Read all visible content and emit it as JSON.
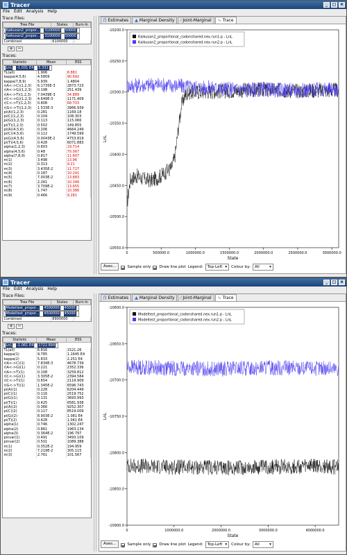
{
  "windows": [
    {
      "title": "Tracer",
      "menu": [
        "File",
        "Edit",
        "Analysis",
        "Help"
      ],
      "trace_files_label": "Trace Files:",
      "trace_file_headers": [
        "Tree File",
        "States",
        "Burn-In"
      ],
      "trace_files": [
        [
          "Kaikusan2_propor...",
          "3100000",
          "50000"
        ],
        [
          "Kaikusan2_propor...",
          "3100000",
          "50000"
        ],
        [
          "Combined",
          "6100000",
          "-"
        ]
      ],
      "trace_files_selected": [
        0,
        1
      ],
      "add_label": "+",
      "remove_label": "−",
      "traces_label": "Traces:",
      "trace_headers": [
        "Statistic",
        "Mean",
        "ESS"
      ],
      "traces": [
        [
          "LnL",
          "-1.031 E4",
          "5.331"
        ],
        [
          "TL(all)",
          "1.906",
          "8.881"
        ],
        [
          "kappa(4,5,6)",
          "4.5809",
          "90.692"
        ],
        [
          "kappa(7,8,9)",
          "5.939",
          "1.4804"
        ],
        [
          "r(A<->C)(1,2,3)",
          "6.1735E-3",
          "2873.723"
        ],
        [
          "r(A<->G)(1,2,3)",
          "0.198",
          "251.439"
        ],
        [
          "r(A<->T)(1,2,3)",
          "7.0439E-3",
          "34.889"
        ],
        [
          "r(C<->G)(1,2,3)",
          "4.649E-3",
          "1171.409"
        ],
        [
          "r(C<->T)(1,2,3)",
          "0.808",
          "68.703"
        ],
        [
          "r(G<->T)(1,2,3)",
          "1.533E-3",
          "3966.939"
        ],
        [
          "pi(A)(1,2,3)",
          "0.281",
          "1169.18"
        ],
        [
          "pi(C)(1,2,3)",
          "0.104",
          "108.303"
        ],
        [
          "pi(G)(1,2,3)",
          "0.113",
          "115.066"
        ],
        [
          "pi(T)(1,2,3)",
          "0.502",
          "149.855"
        ],
        [
          "pi(A)(4,5,6)",
          "0.206",
          "4664.249"
        ],
        [
          "pi(C)(4,5,6)",
          "0.112",
          "1749.599"
        ],
        [
          "pi(G)(4,5,6)",
          "0.0043E-2",
          "4753.819"
        ],
        [
          "pi(T)(4,5,6)",
          "0.428",
          "6071.883"
        ],
        [
          "alpha(1,2,3)",
          "0.603",
          "19.714"
        ],
        [
          "alpha(4,5,6)",
          "0.48",
          "70.067"
        ],
        [
          "alpha(7,8,9)",
          "0.817",
          "11.607"
        ],
        [
          "m(1)",
          "3.498",
          "13.96"
        ],
        [
          "m(2)",
          "0.313",
          "9.21"
        ],
        [
          "m(3)",
          "3.435E-2",
          "11.727"
        ],
        [
          "m(4)",
          "0.187",
          "10.241"
        ],
        [
          "m(5)",
          "7.003E-2",
          "13.883"
        ],
        [
          "m(6)",
          "2.261",
          "10.346"
        ],
        [
          "m(7)",
          "3.709E-2",
          "13.655"
        ],
        [
          "m(8)",
          "1.747",
          "10.386"
        ],
        [
          "m(9)",
          "0.466",
          "9.281"
        ]
      ],
      "trace_ess_red": [
        0,
        1,
        2,
        6,
        8,
        18,
        19,
        20,
        21,
        22,
        23,
        24,
        25,
        26,
        27,
        28,
        29
      ],
      "tabs": [
        "Estimates",
        "Marginal Density",
        "Joint-Marginal",
        "Trace"
      ],
      "active_tab": 3,
      "legend": [
        "Kaikusan2_proportional_codonshared.nex.run1.p - LnL",
        "Kaikusan2_proportional_codonshared.nex.run2.p - LnL"
      ],
      "controls": {
        "axes": "Axes...",
        "sample_only": "Sample only",
        "draw_line": "Draw line plot",
        "legend_label": "Legend:",
        "legend_value": "Top-Left",
        "colour_label": "Colour by:",
        "colour_value": "All"
      },
      "colors": {
        "series1": "#111111",
        "series2": "#4a3cf0"
      },
      "chart_data": {
        "type": "line",
        "xlabel": "State",
        "ylabel": "LnL",
        "xlim": [
          0,
          3100000
        ],
        "ylim": [
          -10550,
          -10200
        ],
        "xticks": [
          "0",
          "500000.0",
          "1000000.0",
          "1500000.0",
          "2000000.0",
          "2500000.0",
          "3000000.0"
        ],
        "yticks": [
          "-10200.0",
          "-10250.0",
          "-10300.0",
          "-10350.0",
          "-10400.0",
          "-10450.0",
          "-10500.0",
          "-10550.0"
        ],
        "series": [
          {
            "name": "Kaikusan2_proportional_codonshared.nex.run1.p - LnL",
            "color": "#111111",
            "x": [
              0,
              50000,
              150000,
              250000,
              350000,
              450000,
              550000,
              650000,
              700000,
              750000,
              800000,
              850000,
              900000,
              1000000,
              1500000,
              2000000,
              2500000,
              3000000
            ],
            "y": [
              -10480,
              -10440,
              -10435,
              -10440,
              -10442,
              -10438,
              -10430,
              -10422,
              -10405,
              -10360,
              -10320,
              -10305,
              -10300,
              -10300,
              -10298,
              -10296,
              -10298,
              -10297
            ]
          },
          {
            "name": "Kaikusan2_proportional_codonshared.nex.run2.p - LnL",
            "color": "#4a3cf0",
            "x": [
              0,
              500000,
              1000000,
              1500000,
              2000000,
              2500000,
              3000000
            ],
            "y": [
              -10290,
              -10288,
              -10292,
              -10295,
              -10296,
              -10297,
              -10296
            ]
          }
        ]
      }
    },
    {
      "title": "Tracer",
      "menu": [
        "File",
        "Edit",
        "Analysis",
        "Help"
      ],
      "trace_files_label": "Trace Files:",
      "trace_file_headers": [
        "Tree File",
        "States",
        "Burn-In"
      ],
      "trace_files": [
        [
          "Modeltest_propor...",
          "4500000",
          "45000"
        ],
        [
          "Modeltest_propor...",
          "4500000",
          "45000"
        ],
        [
          "Combined",
          "8900000",
          "-"
        ]
      ],
      "trace_files_selected": [
        0,
        1
      ],
      "add_label": "+",
      "remove_label": "−",
      "traces_label": "Traces:",
      "trace_headers": [
        "Statistic",
        "Mean",
        "ESS"
      ],
      "traces": [
        [
          "LnL",
          "-1.061 E4",
          "1722.894"
        ],
        [
          "TL(all)",
          "6.816",
          "1521.26"
        ],
        [
          "kappa(1)",
          "9.785",
          "1.1645 E4"
        ],
        [
          "kappa(2)",
          "5.833",
          "2.251 E4"
        ],
        [
          "r(A<->C)(1)",
          "7.834E-3",
          "4678.739"
        ],
        [
          "r(A<->G)(1)",
          "0.221",
          "2352.336"
        ],
        [
          "r(A<->T)(1)",
          "0.108",
          "3259.812"
        ],
        [
          "r(C<->G)(1)",
          "3.305E-2",
          "2394.584"
        ],
        [
          "r(C<->T)(1)",
          "0.654",
          "2119.909"
        ],
        [
          "r(G<->T)(1)",
          "1.345E-2",
          "6596.743"
        ],
        [
          "pi(A)(1)",
          "0.228",
          "6204.449"
        ],
        [
          "pi(C)(1)",
          "0.116",
          "2519.752"
        ],
        [
          "pi(G)(1)",
          "0.131",
          "3693.993"
        ],
        [
          "pi(T)(1)",
          "0.425",
          "6581.938"
        ],
        [
          "pi(A)(2)",
          "0.366",
          "9252.307"
        ],
        [
          "pi(C)(2)",
          "0.117",
          "8519.009"
        ],
        [
          "pi(G)(2)",
          "8.903E-2",
          "1.081 E4"
        ],
        [
          "pi(T)(2)",
          "0.428",
          "1.041 E4"
        ],
        [
          "alpha(1)",
          "0.746",
          "1302.247"
        ],
        [
          "alpha(2)",
          "0.861",
          "1963.134"
        ],
        [
          "alpha(3)",
          "0.364E-2",
          "196.797"
        ],
        [
          "pinvar(1)",
          "0.491",
          "3493.109"
        ],
        [
          "pinvar(2)",
          "0.501",
          "1089.388"
        ],
        [
          "m(1)",
          "0.352E-2",
          "194.959"
        ],
        [
          "m(2)",
          "7.219E-2",
          "305.115"
        ],
        [
          "m(3)",
          "2.761",
          "101.567"
        ]
      ],
      "trace_ess_red": [],
      "tabs": [
        "Estimates",
        "Marginal Density",
        "Joint-Marginal",
        "Trace"
      ],
      "active_tab": 3,
      "legend": [
        "Modeltest_proportional_codonshared.nex.run1.p - LnL",
        "Modeltest_proportional_codonshared.nex.run2.p - LnL"
      ],
      "controls": {
        "axes": "Axes...",
        "sample_only": "Sample only",
        "draw_line": "Draw line plot",
        "legend_label": "Legend:",
        "legend_value": "Top-Left",
        "colour_label": "Colour by:",
        "colour_value": "All"
      },
      "colors": {
        "series1": "#111111",
        "series2": "#4a3cf0"
      },
      "chart_data": {
        "type": "line",
        "xlabel": "State",
        "ylabel": "LnL",
        "xlim": [
          0,
          4500000
        ],
        "ylim": [
          -10900,
          -10600
        ],
        "xticks": [
          "0",
          "1000000.0",
          "2000000.0",
          "3000000.0",
          "4000000.0"
        ],
        "yticks": [
          "-10600.0",
          "-10650.0",
          "-10700.0",
          "-10750.0",
          "-10800.0",
          "-10850.0",
          "-10900.0"
        ],
        "series": [
          {
            "name": "Modeltest_proportional_codonshared.nex.run1.p - LnL",
            "color": "#111111",
            "x": [
              0,
              1000000,
              2000000,
              3000000,
              4000000,
              4500000
            ],
            "y": [
              -10818,
              -10820,
              -10821,
              -10820,
              -10819,
              -10820
            ]
          },
          {
            "name": "Modeltest_proportional_codonshared.nex.run2.p - LnL",
            "color": "#4a3cf0",
            "x": [
              0,
              1000000,
              2000000,
              3000000,
              4000000,
              4500000
            ],
            "y": [
              -10682,
              -10684,
              -10685,
              -10683,
              -10684,
              -10685
            ]
          }
        ]
      }
    }
  ]
}
